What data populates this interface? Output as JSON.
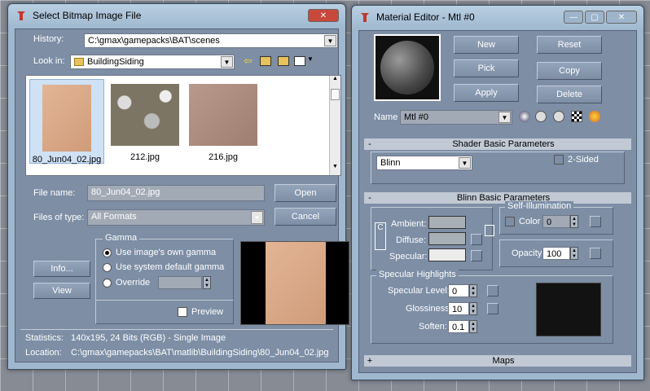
{
  "bitmap_dialog": {
    "title": "Select Bitmap Image File",
    "history_label": "History:",
    "history_value": "C:\\gmax\\gamepacks\\BAT\\scenes",
    "lookin_label": "Look in:",
    "lookin_value": "BuildingSiding",
    "files": [
      "80_Jun04_02.jpg",
      "212.jpg",
      "216.jpg"
    ],
    "filename_label": "File name:",
    "filename_value": "80_Jun04_02.jpg",
    "filetype_label": "Files of type:",
    "filetype_value": "All Formats",
    "open_label": "Open",
    "cancel_label": "Cancel",
    "info_label": "Info...",
    "view_label": "View",
    "gamma_label": "Gamma",
    "gamma_options": [
      "Use image's own gamma",
      "Use system default gamma",
      "Override"
    ],
    "preview_label": "Preview",
    "statistics_label": "Statistics:",
    "statistics_value": "140x195, 24 Bits (RGB) - Single Image",
    "location_label": "Location:",
    "location_value": "C:\\gmax\\gamepacks\\BAT\\matlib\\BuildingSiding\\80_Jun04_02.jpg"
  },
  "material_editor": {
    "title": "Material Editor - Mtl #0",
    "buttons": {
      "new": "New",
      "reset": "Reset",
      "pick": "Pick",
      "copy": "Copy",
      "apply": "Apply",
      "delete": "Delete"
    },
    "name_label": "Name",
    "name_value": "Mtl #0",
    "shader_rollout": "Shader Basic Parameters",
    "shader_value": "Blinn",
    "two_sided_label": "2-Sided",
    "blinn_rollout": "Blinn Basic Parameters",
    "self_illum_label": "Self-Illumination",
    "color_label": "Color",
    "color_value": "0",
    "ambient_label": "Ambient:",
    "diffuse_label": "Diffuse:",
    "specular_label": "Specular:",
    "opacity_label": "Opacity:",
    "opacity_value": "100",
    "spec_highlights_label": "Specular Highlights",
    "spec_level_label": "Specular Level:",
    "spec_level_value": "0",
    "glossiness_label": "Glossiness:",
    "glossiness_value": "10",
    "soften_label": "Soften:",
    "soften_value": "0.1",
    "maps_rollout": "Maps",
    "lock_letter": "C"
  }
}
